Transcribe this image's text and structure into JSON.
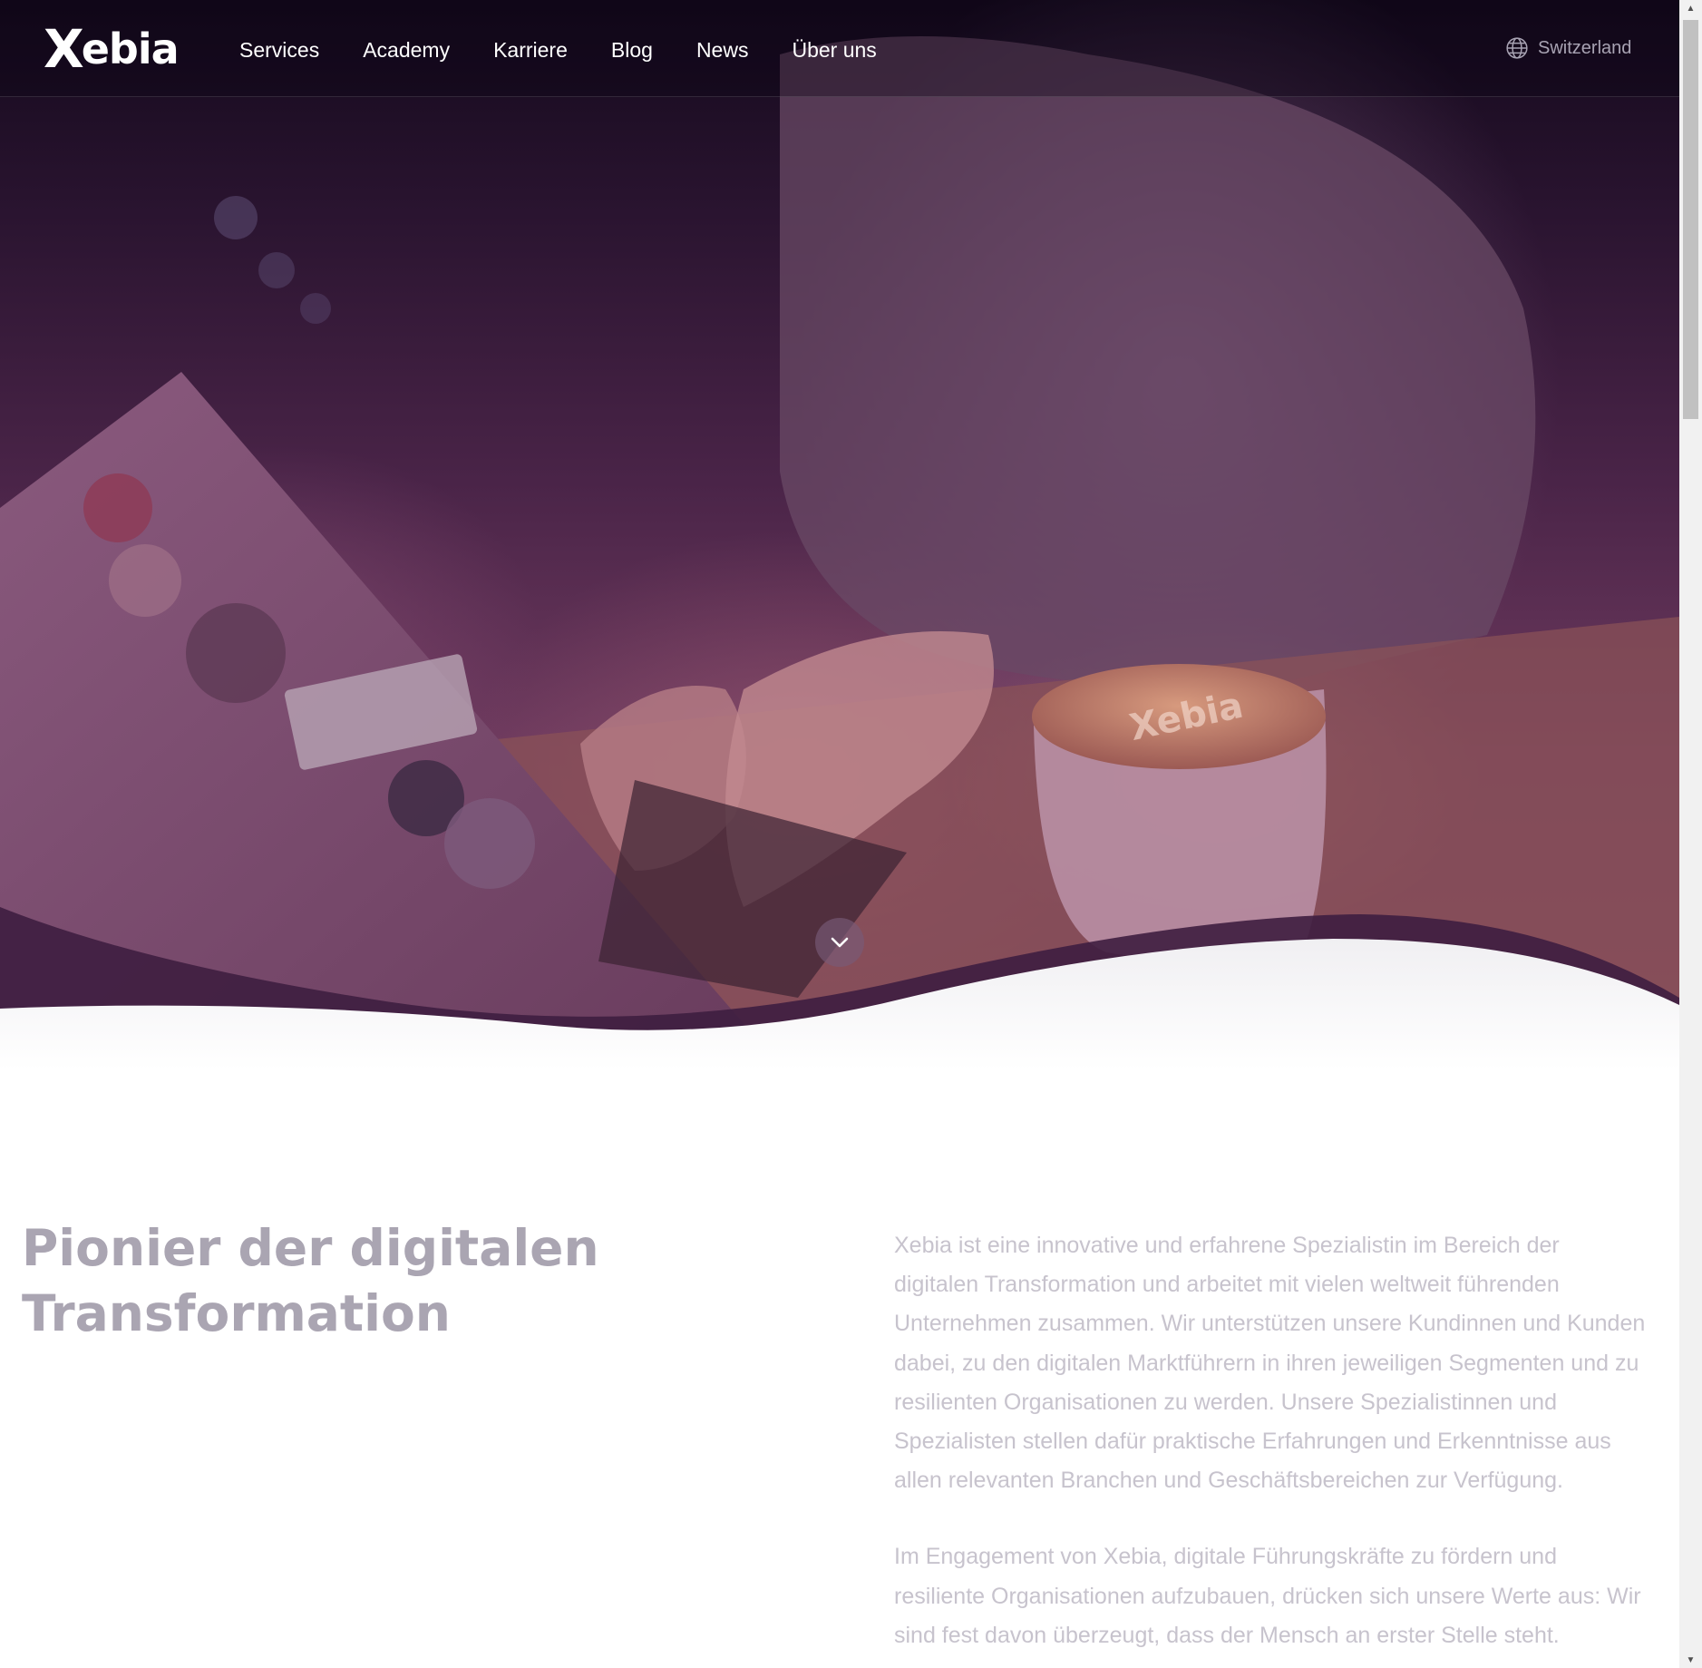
{
  "brand": {
    "logo_text": "ebia",
    "logo_x": "X",
    "logo_alt": "Xebia"
  },
  "nav": {
    "items": [
      "Services",
      "Academy",
      "Karriere",
      "Blog",
      "News",
      "Über uns"
    ],
    "region_label": "Switzerland"
  },
  "hero": {
    "scroll_icon": "chevron-down-icon",
    "cup_logo": "Xebia"
  },
  "intro": {
    "headline_line1": "Pionier der digitalen",
    "headline_line2": "Transformation",
    "paragraph1": "Xebia ist eine innovative und erfahrene Spezialistin im Bereich der digitalen Transformation und arbeitet mit vielen weltweit führenden Unternehmen zusammen. Wir unterstützen unsere Kundinnen und Kunden dabei, zu den digitalen Marktführern in ihren jeweiligen Segmenten und zu resilienten Organisationen zu werden. Unsere Spezialistinnen und Spezialisten stellen dafür praktische Erfahrungen und Erkenntnisse aus allen relevanten Branchen und Geschäftsbereichen zur Verfügung.",
    "paragraph2": "Im Engagement von Xebia, digitale Führungskräfte zu fördern und resiliente Organisationen aufzubauen, drücken sich unsere Werte aus: Wir sind fest davon überzeugt, dass der Mensch an erster Stelle steht."
  },
  "colors": {
    "hero_overlay": "#4a2448",
    "headline": "#aaa5b2",
    "body": "#c7c3cd",
    "nav_text": "#ffffff"
  }
}
